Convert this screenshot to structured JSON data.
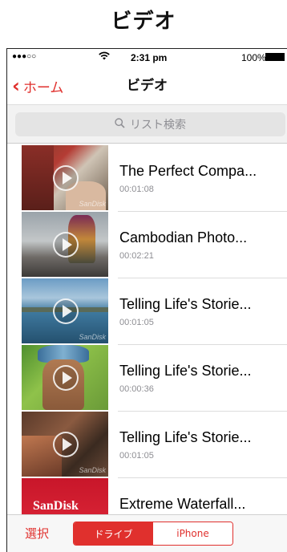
{
  "header": {
    "title": "ビデオ"
  },
  "status_bar": {
    "signal": "●●●○○",
    "time": "2:31 pm",
    "battery_pct": "100%"
  },
  "nav": {
    "back_label": "ホーム",
    "title": "ビデオ"
  },
  "search": {
    "placeholder": "リスト検索"
  },
  "videos": [
    {
      "title": "The Perfect Compa...",
      "duration": "00:01:08"
    },
    {
      "title": "Cambodian Photo...",
      "duration": "00:02:21"
    },
    {
      "title": "Telling Life's Storie...",
      "duration": "00:01:05"
    },
    {
      "title": "Telling Life's Storie...",
      "duration": "00:00:36"
    },
    {
      "title": "Telling Life's Storie...",
      "duration": "00:01:05"
    },
    {
      "title": "Extreme Waterfall...",
      "duration": ""
    }
  ],
  "thumb_watermark": "SanDisk",
  "toolbar": {
    "select_label": "選択",
    "segments": [
      "ドライブ",
      "iPhone"
    ]
  },
  "colors": {
    "accent": "#e0302d"
  }
}
